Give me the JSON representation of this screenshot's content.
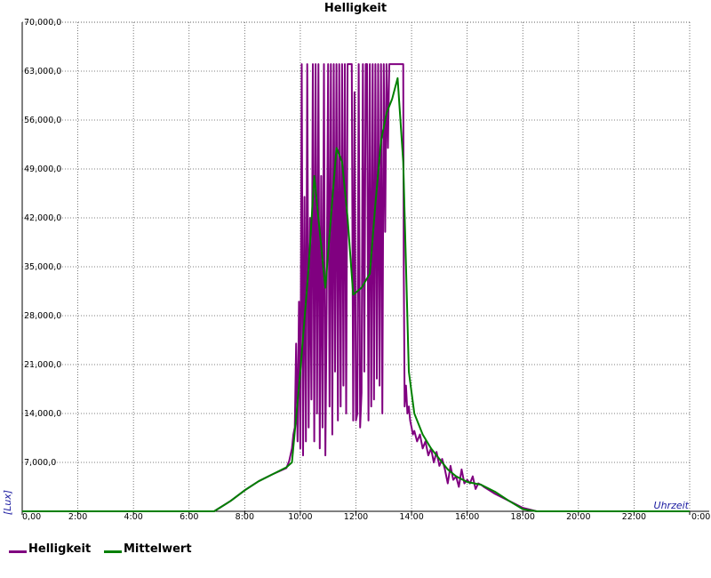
{
  "chart_data": {
    "type": "line",
    "title": "Helligkeit",
    "xlabel": "Uhrzeit",
    "ylabel": "[Lux]",
    "xlim": [
      0,
      24
    ],
    "ylim": [
      0,
      70000
    ],
    "x_ticks": [
      "0,00",
      "2:00",
      "4:00",
      "6:00",
      "8:00",
      "10:00",
      "12:00",
      "14:00",
      "16:00",
      "18:00",
      "20:00",
      "22:00",
      "0:00"
    ],
    "y_ticks": [
      "70,000,0",
      "63,000,0",
      "56,000,0",
      "49,000,0",
      "42,000,0",
      "35,000,0",
      "28,000,0",
      "21,000,0",
      "14,000,0",
      "7,000,0"
    ],
    "grid": true,
    "legend_position": "bottom-left",
    "series": [
      {
        "name": "Helligkeit",
        "color": "#800080",
        "x": [
          0,
          6.9,
          7.5,
          8.0,
          8.5,
          9.0,
          9.5,
          9.6,
          9.7,
          9.75,
          9.8,
          9.85,
          9.9,
          9.95,
          10.0,
          10.05,
          10.1,
          10.15,
          10.2,
          10.25,
          10.3,
          10.35,
          10.4,
          10.45,
          10.5,
          10.55,
          10.6,
          10.65,
          10.7,
          10.75,
          10.8,
          10.85,
          10.9,
          10.95,
          11.0,
          11.05,
          11.1,
          11.15,
          11.2,
          11.25,
          11.3,
          11.35,
          11.4,
          11.45,
          11.5,
          11.55,
          11.6,
          11.65,
          11.7,
          11.75,
          11.8,
          11.85,
          11.9,
          11.95,
          12.0,
          12.05,
          12.1,
          12.15,
          12.2,
          12.25,
          12.3,
          12.35,
          12.4,
          12.45,
          12.5,
          12.55,
          12.6,
          12.65,
          12.7,
          12.75,
          12.8,
          12.85,
          12.9,
          12.95,
          13.0,
          13.05,
          13.1,
          13.15,
          13.2,
          13.3,
          13.4,
          13.5,
          13.6,
          13.7,
          13.72,
          13.75,
          13.8,
          13.85,
          13.9,
          13.95,
          14.0,
          14.05,
          14.1,
          14.2,
          14.3,
          14.4,
          14.5,
          14.6,
          14.7,
          14.8,
          14.9,
          15.0,
          15.1,
          15.2,
          15.3,
          15.4,
          15.5,
          15.6,
          15.7,
          15.8,
          15.9,
          16.0,
          16.1,
          16.2,
          16.3,
          16.4,
          16.5,
          16.6,
          16.8,
          17.0,
          17.5,
          18.0,
          18.5,
          19.0,
          24
        ],
        "values": [
          0,
          0,
          1500,
          3000,
          4300,
          5300,
          6200,
          7200,
          9000,
          11000,
          12000,
          24000,
          10000,
          30000,
          9000,
          64000,
          8000,
          45000,
          10000,
          64000,
          12000,
          42000,
          16000,
          64000,
          10000,
          64000,
          14000,
          64000,
          9000,
          48000,
          12000,
          64000,
          8000,
          30000,
          64000,
          15000,
          64000,
          11000,
          64000,
          20000,
          64000,
          13000,
          64000,
          15000,
          64000,
          18000,
          64000,
          14000,
          64000,
          64000,
          64000,
          64000,
          13000,
          60000,
          13000,
          14000,
          64000,
          12000,
          17000,
          64000,
          20000,
          64000,
          64000,
          13000,
          64000,
          15000,
          64000,
          16000,
          64000,
          19000,
          64000,
          18000,
          64000,
          14000,
          64000,
          40000,
          64000,
          52000,
          64000,
          64000,
          64000,
          64000,
          64000,
          64000,
          35000,
          15000,
          18000,
          14000,
          15000,
          13000,
          12000,
          11000,
          11500,
          10000,
          11000,
          9000,
          10000,
          8000,
          9000,
          7000,
          8500,
          6500,
          7500,
          6000,
          4000,
          6500,
          4500,
          5000,
          3500,
          6000,
          4000,
          4500,
          4000,
          5000,
          3200,
          4000,
          3800,
          3500,
          3000,
          2500,
          1500,
          500,
          0,
          0,
          0
        ],
        "label_note": ""
      },
      {
        "name": "Mittelwert",
        "color": "#008000",
        "x": [
          0,
          6.9,
          7.5,
          8.0,
          8.5,
          9.0,
          9.5,
          9.7,
          10.0,
          10.3,
          10.5,
          10.7,
          10.9,
          11.1,
          11.3,
          11.5,
          11.7,
          11.9,
          12.2,
          12.5,
          12.7,
          12.9,
          13.1,
          13.3,
          13.5,
          13.7,
          13.9,
          14.1,
          14.4,
          14.7,
          15.0,
          15.3,
          15.6,
          16.0,
          16.5,
          17.0,
          17.5,
          18.0,
          18.5,
          19.0,
          24
        ],
        "values": [
          0,
          0,
          1500,
          3000,
          4300,
          5300,
          6300,
          7000,
          20000,
          35000,
          48000,
          40000,
          32000,
          42000,
          52000,
          50000,
          42000,
          31000,
          32000,
          34000,
          44000,
          53000,
          57000,
          59000,
          62000,
          50000,
          20000,
          14000,
          11000,
          9000,
          7500,
          6000,
          5000,
          4200,
          3800,
          2800,
          1500,
          300,
          0,
          0,
          0
        ]
      }
    ]
  }
}
